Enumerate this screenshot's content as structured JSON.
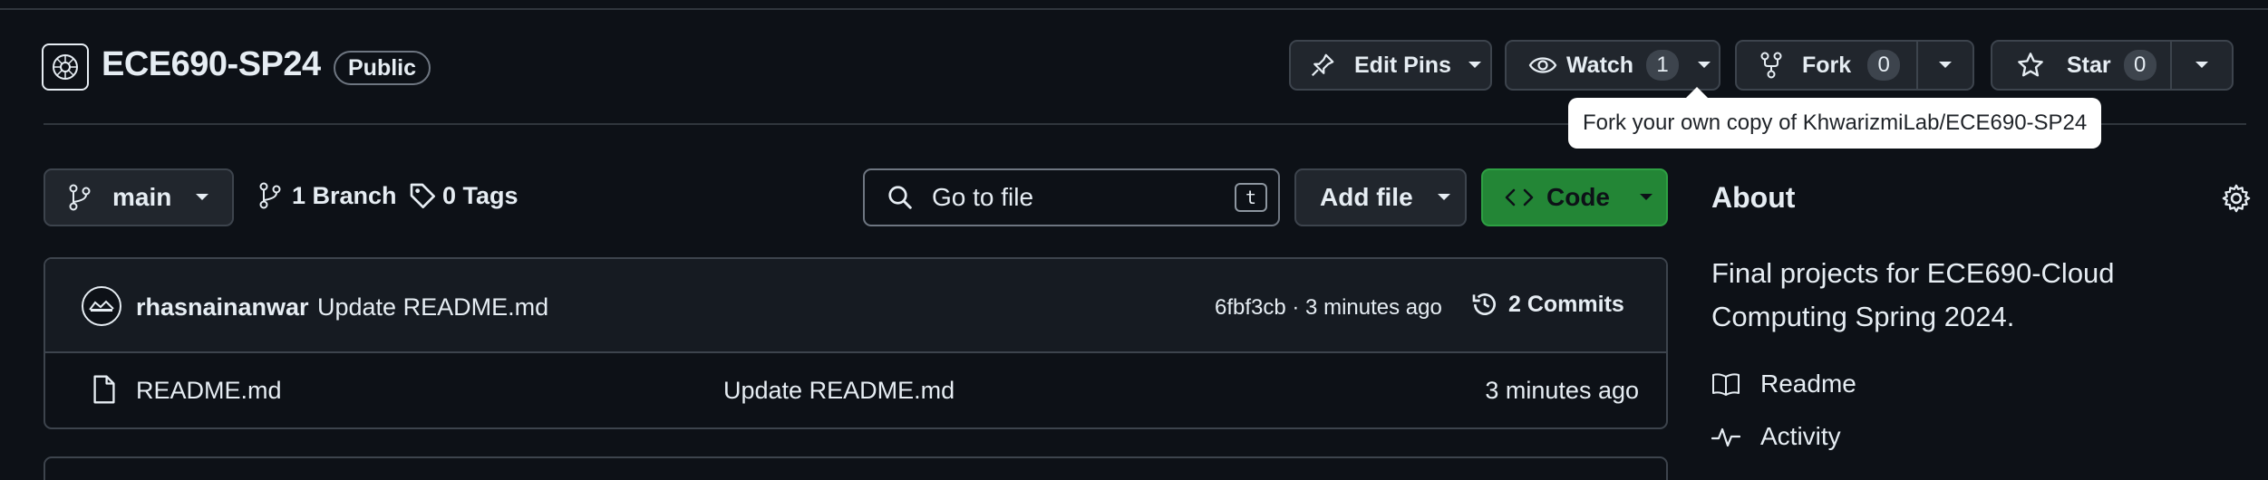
{
  "repo": {
    "name": "ECE690-SP24",
    "visibility": "Public"
  },
  "header_actions": {
    "edit_pins": "Edit Pins",
    "watch": "Watch",
    "watch_count": "1",
    "fork": "Fork",
    "fork_count": "0",
    "star": "Star",
    "star_count": "0"
  },
  "tooltip": "Fork your own copy of KhwarizmiLab/ECE690-SP24",
  "toolbar": {
    "branch": "main",
    "branches": "1 Branch",
    "tags": "0 Tags",
    "search_placeholder": "Go to file",
    "search_shortcut": "t",
    "add_file": "Add file",
    "code": "Code"
  },
  "latest_commit": {
    "author": "rhasnainanwar",
    "message": "Update README.md",
    "meta": "6fbf3cb · 3 minutes ago",
    "commits": "2 Commits"
  },
  "files": [
    {
      "name": "README.md",
      "message": "Update README.md",
      "time": "3 minutes ago"
    }
  ],
  "about": {
    "title": "About",
    "description": "Final projects for ECE690-Cloud Computing Spring 2024.",
    "links": [
      {
        "label": "Readme",
        "icon": "book-icon"
      },
      {
        "label": "Activity",
        "icon": "pulse-icon"
      }
    ]
  },
  "colors": {
    "background": "#0d1117",
    "border": "#3d444d",
    "code_button": "#238636",
    "text": "#e6edf3"
  }
}
